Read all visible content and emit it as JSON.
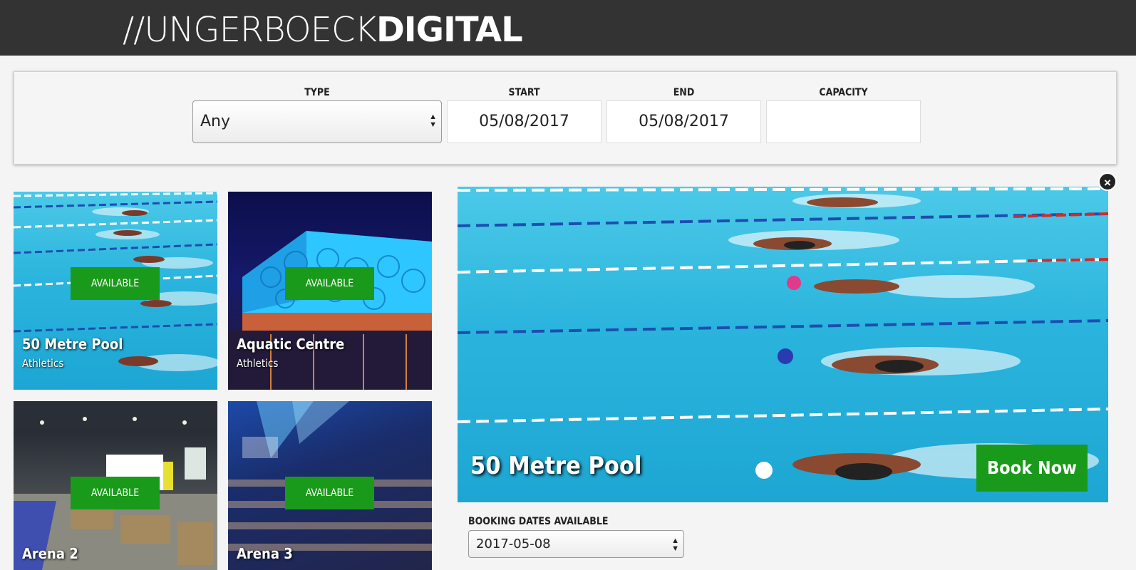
{
  "header": {
    "logo_prefix": "//",
    "logo_light": "UNGERBOECK",
    "logo_bold": "DIGITAL"
  },
  "filters": {
    "type_label": "TYPE",
    "type_value": "Any",
    "start_label": "START",
    "start_value": "05/08/2017",
    "end_label": "END",
    "end_value": "05/08/2017",
    "capacity_label": "CAPACITY",
    "capacity_value": ""
  },
  "venues": [
    {
      "name": "50 Metre Pool",
      "category": "Athletics",
      "status": "AVAILABLE"
    },
    {
      "name": "Aquatic Centre",
      "category": "Athletics",
      "status": "AVAILABLE"
    },
    {
      "name": "Arena 2",
      "category": "",
      "status": "AVAILABLE"
    },
    {
      "name": "Arena 3",
      "category": "",
      "status": "AVAILABLE"
    }
  ],
  "detail": {
    "title": "50 Metre Pool",
    "book_label": "Book Now",
    "close_icon": "×",
    "booking_dates_label": "BOOKING DATES AVAILABLE",
    "booking_date_value": "2017-05-08"
  },
  "colors": {
    "header_bg": "#333333",
    "accent_green": "#1a9a1a"
  }
}
